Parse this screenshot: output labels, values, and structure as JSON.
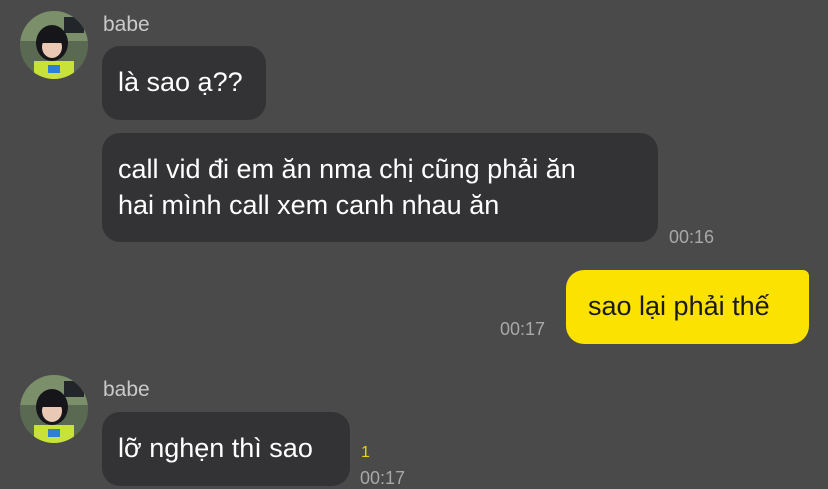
{
  "chat": {
    "messages": [
      {
        "sender": "babe",
        "avatar_icon": "profile-photo-girl-icon",
        "bubbles": [
          "là sao ạ??"
        ]
      },
      {
        "lines": [
          "call vid đi em ăn nma chị cũng phải ăn",
          "hai mình call xem canh nhau ăn"
        ],
        "time": "00:16"
      },
      {
        "direction": "outgoing",
        "text": "sao lại phải thế",
        "time": "00:17"
      },
      {
        "sender": "babe",
        "avatar_icon": "profile-photo-girl-icon",
        "text": "lỡ nghẹn thì sao",
        "unread_count": "1",
        "time": "00:17"
      }
    ]
  },
  "colors": {
    "background": "#4b4a4b",
    "incoming_bubble": "#333234",
    "outgoing_bubble": "#fbe200",
    "unread_count": "#f2d200"
  }
}
